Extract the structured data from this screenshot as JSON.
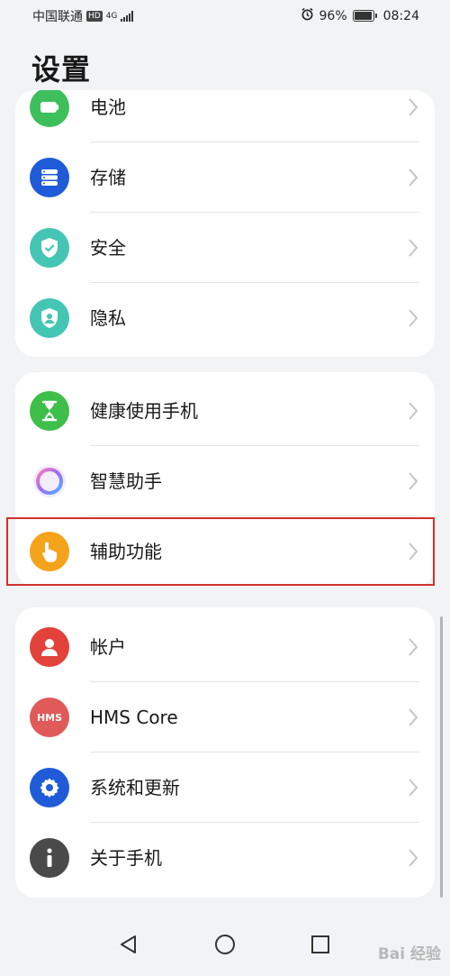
{
  "status_bar": {
    "carrier": "中国联通",
    "hd": "HD",
    "network": "4G",
    "battery_percent": "96%",
    "time": "08:24",
    "battery_level": 0.96,
    "icons": [
      "alarm-icon",
      "battery-icon",
      "signal-icon"
    ]
  },
  "page": {
    "title": "设置"
  },
  "groups": [
    {
      "items": [
        {
          "label": "电池",
          "icon": "battery-settings-icon",
          "color": "#3dbf5c"
        },
        {
          "label": "存储",
          "icon": "storage-icon",
          "color": "#1f5bd8"
        },
        {
          "label": "安全",
          "icon": "shield-check-icon",
          "color": "#45c5b4"
        },
        {
          "label": "隐私",
          "icon": "privacy-icon",
          "color": "#45c5b4"
        }
      ]
    },
    {
      "items": [
        {
          "label": "健康使用手机",
          "icon": "hourglass-icon",
          "color": "#3dbf4a"
        },
        {
          "label": "智慧助手",
          "icon": "assistant-ring-icon",
          "color": "#b96ae0"
        },
        {
          "label": "辅助功能",
          "icon": "accessibility-hand-icon",
          "color": "#f5a31a"
        }
      ]
    },
    {
      "items": [
        {
          "label": "帐户",
          "icon": "account-icon",
          "color": "#e2423a"
        },
        {
          "label": "HMS Core",
          "icon": "hms-core-icon",
          "color": "#e05a5a",
          "badge_text": "HMS"
        },
        {
          "label": "系统和更新",
          "icon": "gear-icon",
          "color": "#1f5bd8"
        },
        {
          "label": "关于手机",
          "icon": "info-icon",
          "color": "#4a4a4a"
        }
      ]
    }
  ],
  "highlight_color": "#d0312d",
  "nav": {
    "icons": [
      "back-icon",
      "home-icon",
      "recents-icon"
    ]
  },
  "watermark": {
    "text": "Bai 经验"
  }
}
